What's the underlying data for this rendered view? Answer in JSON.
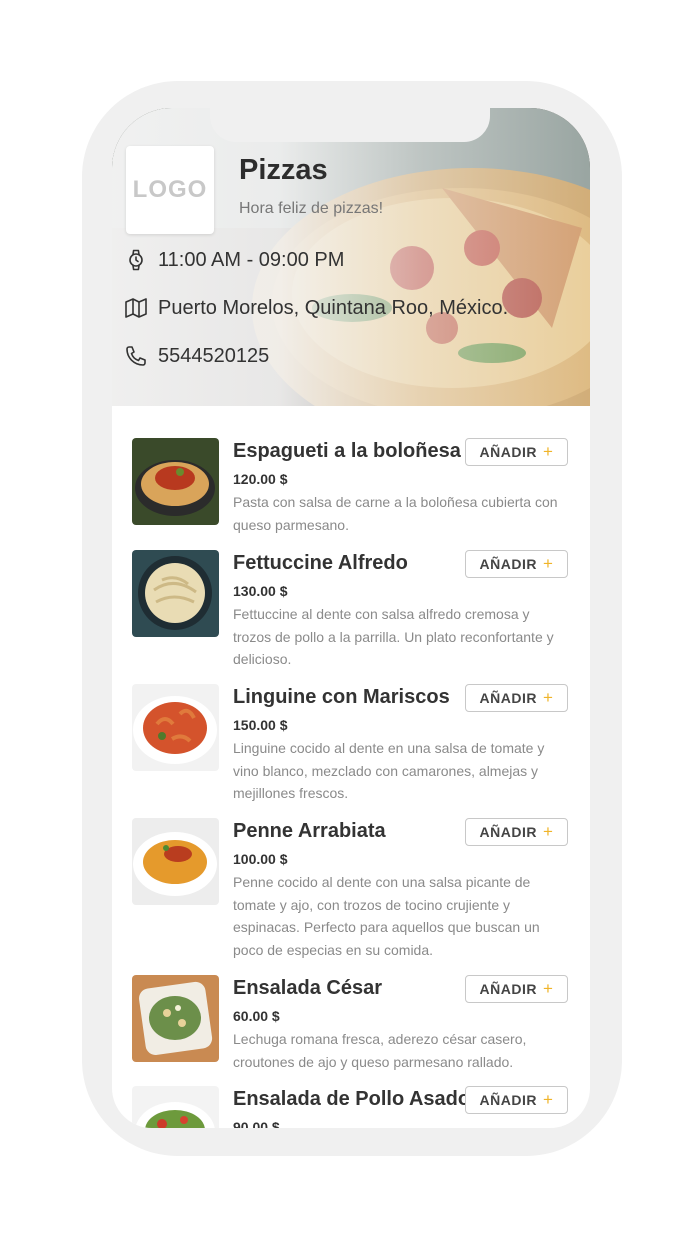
{
  "header": {
    "logo_text": "LOGO",
    "title": "Pizzas",
    "subtitle": "Hora feliz de pizzas!",
    "hours": "11:00 AM - 09:00 PM",
    "address": "Puerto Morelos, Quintana Roo, México.",
    "phone": "5544520125",
    "icons": {
      "hours": "watch-icon",
      "address": "map-icon",
      "phone": "phone-icon"
    }
  },
  "add_button": {
    "label": "AÑADIR",
    "icon": "plus-icon",
    "plus_color": "#f0b429"
  },
  "items": [
    {
      "name": "Espagueti a la boloñesa",
      "price": "120.00 $",
      "description": "Pasta con salsa de carne a la boloñesa cubierta con queso parmesano.",
      "add_label": "AÑADIR"
    },
    {
      "name": "Fettuccine Alfredo",
      "price": "130.00 $",
      "description": "Fettuccine al dente con salsa alfredo cremosa y trozos de pollo a la parrilla. Un plato reconfortante y delicioso.",
      "add_label": "AÑADIR"
    },
    {
      "name": "Linguine con Mariscos",
      "price": "150.00 $",
      "description": "Linguine cocido al dente en una salsa de tomate y vino blanco, mezclado con camarones, almejas y mejillones frescos.",
      "add_label": "AÑADIR"
    },
    {
      "name": "Penne Arrabiata",
      "price": "100.00 $",
      "description": "Penne cocido al dente con una salsa picante de tomate y ajo, con trozos de tocino crujiente y espinacas. Perfecto para aquellos que buscan un poco de especias en su comida.",
      "add_label": "AÑADIR"
    },
    {
      "name": "Ensalada César",
      "price": "60.00 $",
      "description": "Lechuga romana fresca, aderezo césar casero, croutones de ajo y queso parmesano rallado.",
      "add_label": "AÑADIR"
    },
    {
      "name": "Ensalada de Pollo Asado",
      "price": "90.00 $",
      "description": "",
      "add_label": "AÑADIR"
    }
  ]
}
